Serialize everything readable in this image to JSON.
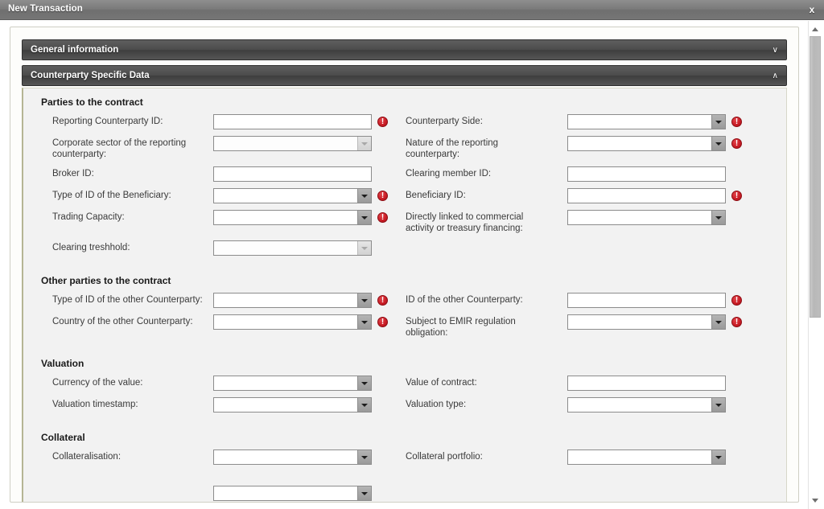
{
  "window": {
    "title": "New Transaction",
    "close_label": "x"
  },
  "accordion": [
    {
      "label": "General information",
      "chevron": "∨",
      "state": "collapsed"
    },
    {
      "label": "Counterparty Specific Data",
      "chevron": "∧",
      "state": "expanded"
    }
  ],
  "sections": [
    {
      "title": "Parties to the contract",
      "rows": [
        {
          "left": {
            "label": "Reporting Counterparty ID:",
            "type": "text",
            "value": "",
            "error": true
          },
          "right": {
            "label": "Counterparty Side:",
            "type": "dropdown",
            "value": "",
            "disabled": false,
            "error": true
          }
        },
        {
          "left": {
            "label": "Corporate sector of the reporting counterparty:",
            "type": "dropdown",
            "value": "",
            "disabled": true,
            "error": false
          },
          "right": {
            "label": "Nature of the reporting counterparty:",
            "type": "dropdown",
            "value": "",
            "disabled": false,
            "error": true
          }
        },
        {
          "left": {
            "label": "Broker ID:",
            "type": "text",
            "value": "",
            "error": false
          },
          "right": {
            "label": "Clearing member ID:",
            "type": "text",
            "value": "",
            "error": false
          }
        },
        {
          "left": {
            "label": "Type of ID of the Beneficiary:",
            "type": "dropdown",
            "value": "",
            "disabled": false,
            "error": true
          },
          "right": {
            "label": "Beneficiary ID:",
            "type": "text",
            "value": "",
            "error": true
          }
        },
        {
          "left": {
            "label": "Trading Capacity:",
            "type": "dropdown",
            "value": "",
            "disabled": false,
            "error": true
          },
          "right": {
            "label": "Directly linked to commercial activity or treasury financing:",
            "type": "dropdown",
            "value": "",
            "disabled": false,
            "error": false
          }
        },
        {
          "left": {
            "label": "Clearing treshhold:",
            "type": "dropdown",
            "value": "",
            "disabled": true,
            "error": false
          },
          "right": null
        }
      ]
    },
    {
      "title": "Other parties to the contract",
      "rows": [
        {
          "left": {
            "label": "Type of ID of the other Counterparty:",
            "type": "dropdown",
            "value": "",
            "disabled": false,
            "error": true
          },
          "right": {
            "label": "ID of the other Counterparty:",
            "type": "text",
            "value": "",
            "error": true
          }
        },
        {
          "left": {
            "label": "Country of the other Counterparty:",
            "type": "dropdown",
            "value": "",
            "disabled": false,
            "error": true
          },
          "right": {
            "label": "Subject to EMIR regulation obligation:",
            "type": "dropdown",
            "value": "",
            "disabled": false,
            "error": true
          }
        }
      ]
    },
    {
      "title": "Valuation",
      "rows": [
        {
          "left": {
            "label": "Currency of the value:",
            "type": "dropdown",
            "value": "",
            "disabled": false,
            "error": false
          },
          "right": {
            "label": "Value of contract:",
            "type": "text",
            "value": "",
            "error": false
          }
        },
        {
          "left": {
            "label": "Valuation timestamp:",
            "type": "dropdown",
            "value": "",
            "disabled": false,
            "error": false
          },
          "right": {
            "label": "Valuation type:",
            "type": "dropdown",
            "value": "",
            "disabled": false,
            "error": false
          }
        }
      ]
    },
    {
      "title": "Collateral",
      "rows": [
        {
          "left": {
            "label": "Collateralisation:",
            "type": "dropdown",
            "value": "",
            "disabled": false,
            "error": false
          },
          "right": {
            "label": "Collateral portfolio:",
            "type": "dropdown",
            "value": "",
            "disabled": false,
            "error": false
          }
        }
      ]
    }
  ],
  "colors": {
    "error": "#cc1f28",
    "header_bar": "#4c4c4c",
    "panel_bg": "#f2f2f2",
    "titlebar": "#7b7b7b"
  }
}
